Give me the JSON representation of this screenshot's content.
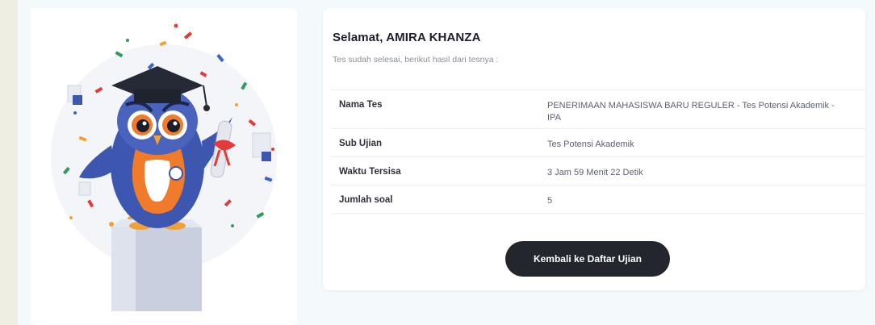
{
  "result": {
    "greeting": "Selamat, AMIRA KHANZA",
    "subtitle": "Tes sudah selesai, berikut hasil dari tesnya :",
    "rows": [
      {
        "label": "Nama Tes",
        "value": "PENERIMAAN MAHASISWA BARU REGULER - Tes Potensi Akademik - IPA"
      },
      {
        "label": "Sub Ujian",
        "value": "Tes Potensi Akademik"
      },
      {
        "label": "Waktu Tersisa",
        "value": "3 Jam 59 Menit 22 Detik"
      },
      {
        "label": "Jumlah soal",
        "value": "5"
      }
    ],
    "back_button_label": "Kembali ke Daftar Ujian"
  },
  "colors": {
    "button_bg": "#24262e",
    "owl_body": "#3d56b0",
    "owl_belly": "#f07b2a",
    "cap": "#262a36"
  }
}
